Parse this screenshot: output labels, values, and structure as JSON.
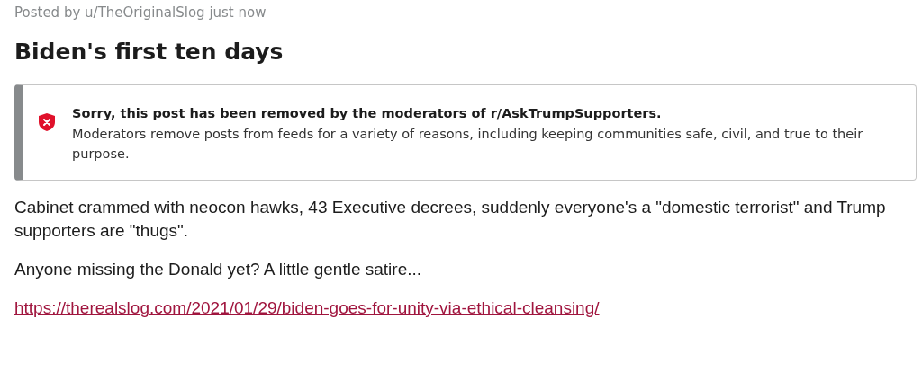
{
  "post": {
    "byline": "Posted by u/TheOriginalSlog just now",
    "title": "Biden's first ten days"
  },
  "removal_notice": {
    "heading": "Sorry, this post has been removed by the moderators of r/AskTrumpSupporters.",
    "message": "Moderators remove posts from feeds for a variety of reasons, including keeping communities safe, civil, and true to their purpose."
  },
  "body": [
    {
      "kind": "text",
      "text": "Cabinet crammed with neocon hawks, 43 Executive decrees, suddenly everyone's a \"domestic terrorist\" and Trump supporters are \"thugs\"."
    },
    {
      "kind": "text",
      "text": "Anyone missing the Donald yet? A little gentle satire..."
    },
    {
      "kind": "link",
      "text": "https://therealslog.com/2021/01/29/biden-goes-for-unity-via-ethical-cleansing/"
    }
  ]
}
